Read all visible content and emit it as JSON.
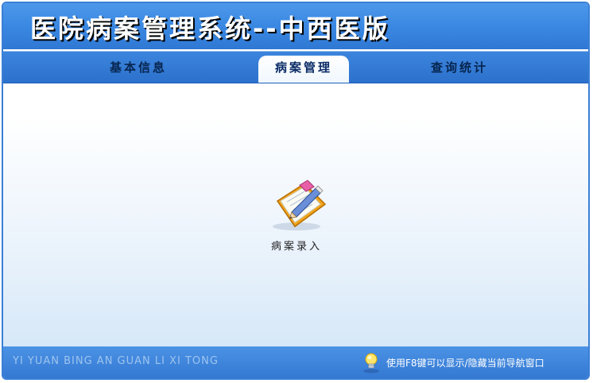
{
  "app": {
    "title": "医院病案管理系统--中西医版"
  },
  "tabs": [
    {
      "label": "基本信息"
    },
    {
      "label": "病案管理"
    },
    {
      "label": "查询统计"
    }
  ],
  "main": {
    "launchers": [
      {
        "label": "病案录入",
        "icon": "clipboard-pencil-icon"
      }
    ]
  },
  "footer": {
    "pinyin": "YI YUAN BING AN GUAN LI XI TONG",
    "hint": "使用F8键可以显示/隐藏当前导航窗口",
    "hint_icon": "lightbulb-icon"
  },
  "colors": {
    "accent": "#3a88e2",
    "footer_text": "#9ec4ee",
    "tab_text": "#07254f"
  }
}
